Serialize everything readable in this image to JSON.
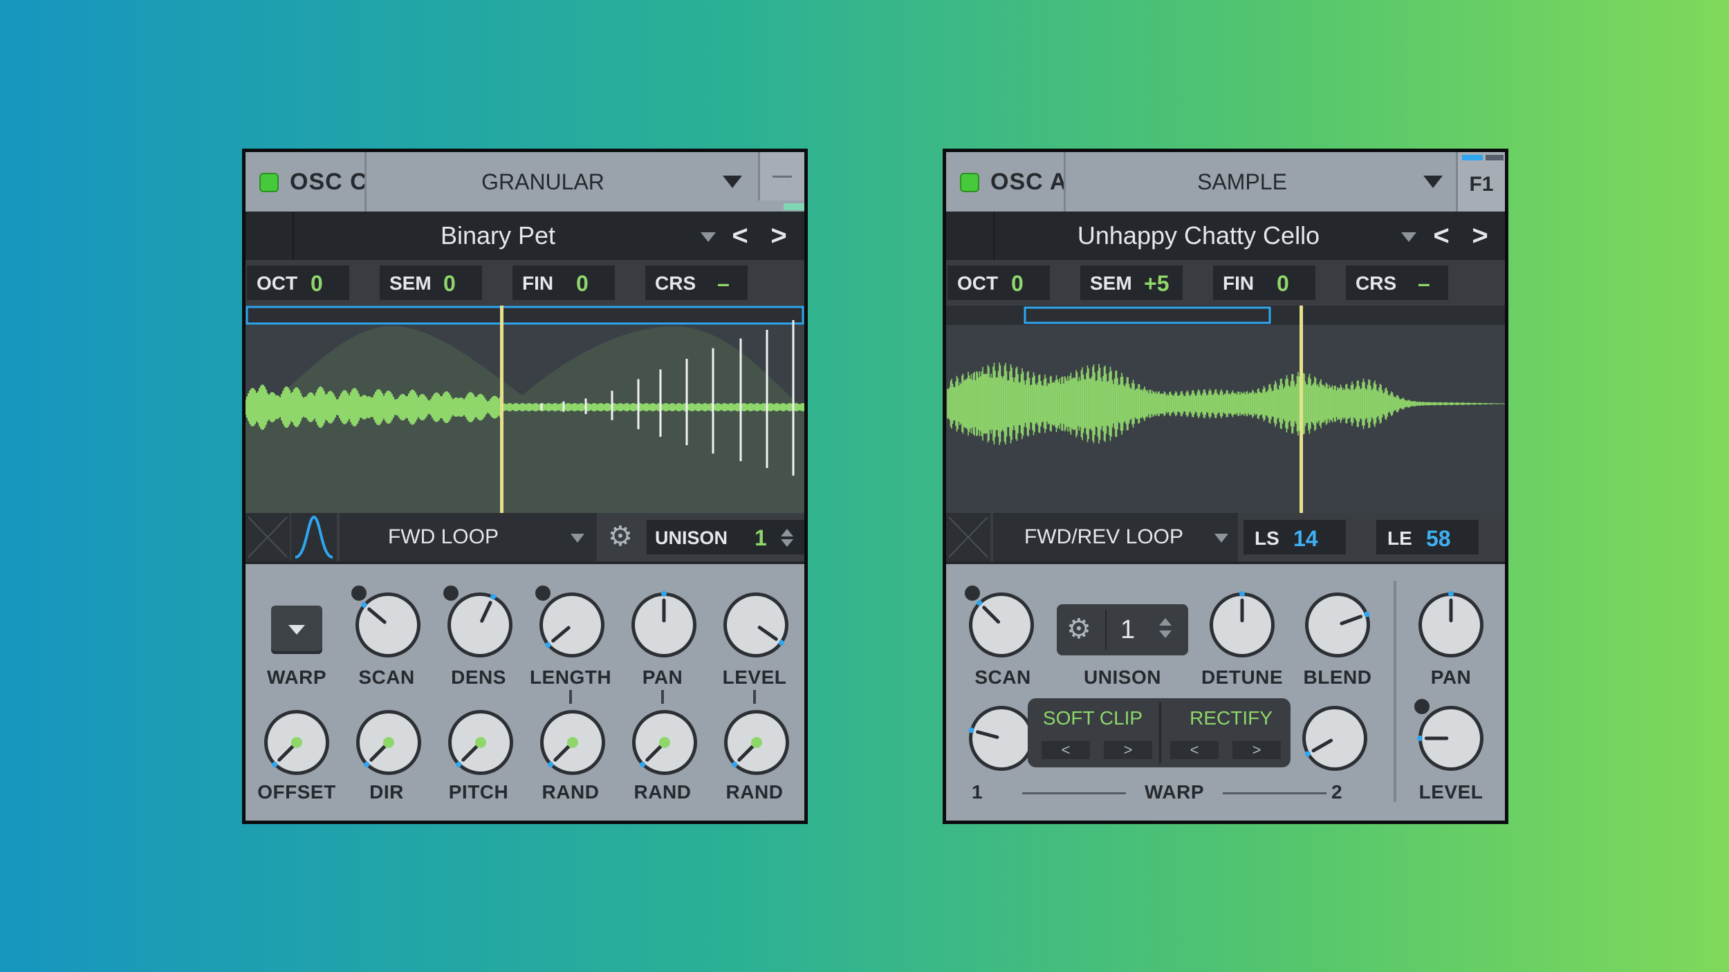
{
  "panels": {
    "osc_c": {
      "name": "OSC C",
      "type": "GRANULAR",
      "preset": "Binary Pet",
      "nav_prev": "<",
      "nav_next": ">",
      "pitch": [
        {
          "label": "OCT",
          "value": "0"
        },
        {
          "label": "SEM",
          "value": "0"
        },
        {
          "label": "FIN",
          "value": "0"
        },
        {
          "label": "CRS",
          "value": "–"
        }
      ],
      "loop_mode": "FWD LOOP",
      "unison_label": "UNISON",
      "unison_value": "1",
      "knobs_top": [
        "SCAN",
        "DENS",
        "LENGTH",
        "PAN",
        "LEVEL"
      ],
      "warp_label": "WARP",
      "knobs_bottom": [
        "OFFSET",
        "DIR",
        "PITCH",
        "RAND",
        "RAND",
        "RAND"
      ],
      "waveform_color": "#8fd66b",
      "playhead_color": "#e7e08a",
      "region_color": "#2fa6f0"
    },
    "osc_a": {
      "name": "OSC A",
      "type": "SAMPLE",
      "f1": "F1",
      "preset": "Unhappy Chatty Cello",
      "nav_prev": "<",
      "nav_next": ">",
      "pitch": [
        {
          "label": "OCT",
          "value": "0"
        },
        {
          "label": "SEM",
          "value": "+5"
        },
        {
          "label": "FIN",
          "value": "0"
        },
        {
          "label": "CRS",
          "value": "–"
        }
      ],
      "loop_mode": "FWD/REV LOOP",
      "ls_label": "LS",
      "ls_value": "14",
      "le_label": "LE",
      "le_value": "58",
      "knobs": {
        "scan": "SCAN",
        "unison": "UNISON",
        "unison_value": "1",
        "detune": "DETUNE",
        "blend": "BLEND",
        "pan": "PAN",
        "level": "LEVEL"
      },
      "warp": {
        "soft_clip": "SOFT CLIP",
        "rectify": "RECTIFY",
        "prev": "<",
        "next": ">",
        "label": "WARP",
        "one": "1",
        "two": "2"
      }
    }
  }
}
